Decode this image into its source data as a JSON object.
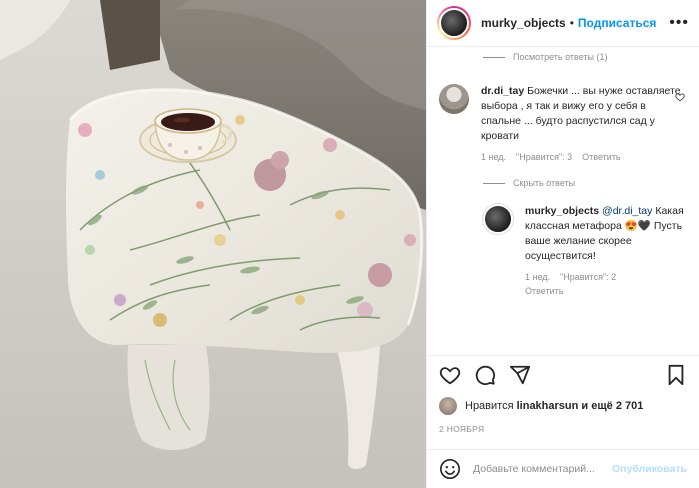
{
  "post": {
    "author": "murky_objects",
    "separator": "•",
    "follow_label": "Подписаться",
    "more_icon": "more-horizontal-icon"
  },
  "comments": {
    "view_replies_label": "Посмотреть ответы (1)",
    "hide_replies_label": "Скрыть ответы",
    "items": [
      {
        "username": "dr.di_tay",
        "text": "Божечки ... вы нуже оставляете выбора , я так и вижу его у себя в спальне ... будто распустился сад у кровати",
        "time": "1 нед.",
        "likes": "\"Нравится\": 3",
        "reply": "Ответить"
      },
      {
        "username": "murky_objects",
        "mention": "@dr.di_tay",
        "text_line1": "Какая классная метафора",
        "emoji": "😍🖤",
        "text_line2": "Пусть ваше желание скорее осуществится!",
        "time": "1 нед.",
        "likes": "\"Нравится\": 2",
        "reply": "Ответить"
      }
    ]
  },
  "likes": {
    "prefix": "Нравится",
    "user": "linakharsun",
    "suffix": "и ещё 2 701"
  },
  "date": "2 НОЯБРЯ",
  "add_comment": {
    "placeholder": "Добавьте комментарий...",
    "publish_label": "Опубликовать"
  },
  "colors": {
    "accent": "#0095f6",
    "publish_disabled": "#b2dffc",
    "muted": "#8e8e8e",
    "text": "#262626"
  }
}
